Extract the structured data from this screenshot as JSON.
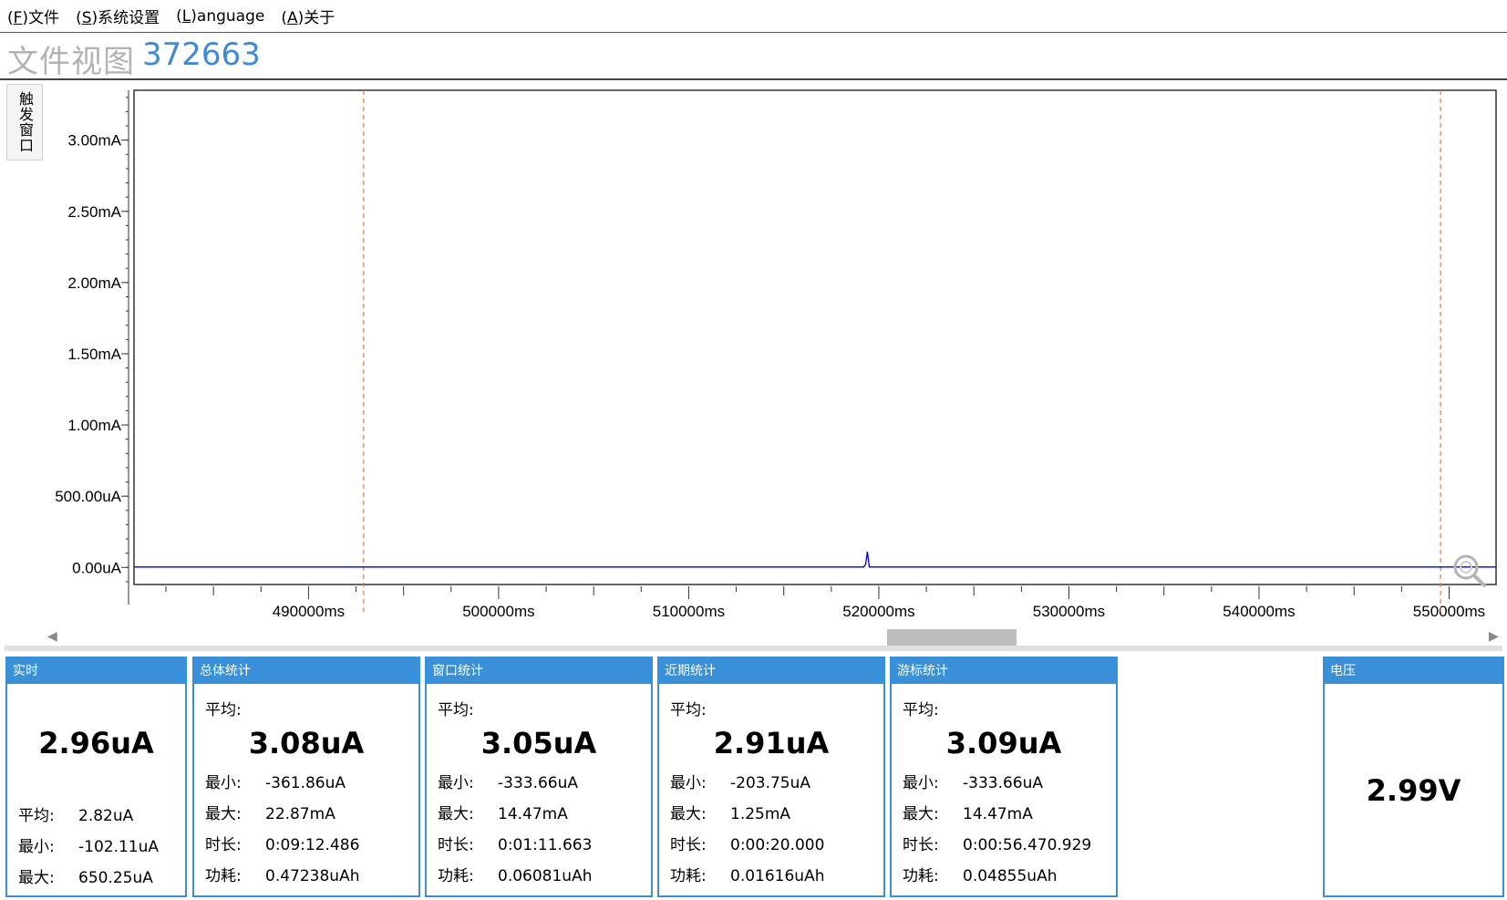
{
  "menu": [
    {
      "mnemonic": "F",
      "label": "文件"
    },
    {
      "mnemonic": "S",
      "label": "系统设置"
    },
    {
      "mnemonic": "L",
      "label": "anguage"
    },
    {
      "mnemonic": "A",
      "label": "关于"
    }
  ],
  "title": "文件视图",
  "title_id": "372663",
  "trigger_button": "触发窗口",
  "colors": {
    "accent": "#3a8fd9",
    "trace": "#0000cc",
    "cursor": "#d9834a"
  },
  "chart_data": {
    "type": "line",
    "y_ticks": [
      "3.00mA",
      "2.50mA",
      "2.00mA",
      "1.50mA",
      "1.00mA",
      "500.00uA",
      "0.00uA"
    ],
    "y_tick_values": [
      3.0,
      2.5,
      2.0,
      1.5,
      1.0,
      0.5,
      0.0
    ],
    "ylim": [
      -0.12,
      3.35
    ],
    "x_ticks": [
      "490000ms",
      "500000ms",
      "510000ms",
      "520000ms",
      "530000ms",
      "540000ms",
      "550000ms"
    ],
    "x_tick_values": [
      490000,
      500000,
      510000,
      520000,
      530000,
      540000,
      550000
    ],
    "xlim": [
      480820,
      552470
    ],
    "cursors_x": [
      492900,
      549550
    ],
    "series": [
      {
        "x": [
          480820,
          519200,
          519300,
          519400,
          519500,
          552470
        ],
        "y": [
          0.003,
          0.003,
          0.02,
          0.11,
          0.003,
          0.003
        ]
      }
    ]
  },
  "panels": [
    {
      "title": "实时",
      "big": "2.96uA",
      "rows": [
        {
          "label": "平均:",
          "value": "2.82uA"
        },
        {
          "label": "最小:",
          "value": "-102.11uA"
        },
        {
          "label": "最大:",
          "value": "650.25uA"
        }
      ]
    },
    {
      "title": "总体统计",
      "avg_label": "平均:",
      "big": "3.08uA",
      "rows": [
        {
          "label": "最小:",
          "value": "-361.86uA"
        },
        {
          "label": "最大:",
          "value": "22.87mA"
        },
        {
          "label": "时长:",
          "value": "0:09:12.486"
        },
        {
          "label": "功耗:",
          "value": "0.47238uAh"
        }
      ]
    },
    {
      "title": "窗口统计",
      "avg_label": "平均:",
      "big": "3.05uA",
      "rows": [
        {
          "label": "最小:",
          "value": "-333.66uA"
        },
        {
          "label": "最大:",
          "value": "14.47mA"
        },
        {
          "label": "时长:",
          "value": "0:01:11.663"
        },
        {
          "label": "功耗:",
          "value": "0.06081uAh"
        }
      ]
    },
    {
      "title": "近期统计",
      "avg_label": "平均:",
      "big": "2.91uA",
      "rows": [
        {
          "label": "最小:",
          "value": "-203.75uA"
        },
        {
          "label": "最大:",
          "value": "1.25mA"
        },
        {
          "label": "时长:",
          "value": "0:00:20.000"
        },
        {
          "label": "功耗:",
          "value": "0.01616uAh"
        }
      ]
    },
    {
      "title": "游标统计",
      "avg_label": "平均:",
      "big": "3.09uA",
      "rows": [
        {
          "label": "最小:",
          "value": "-333.66uA"
        },
        {
          "label": "最大:",
          "value": "14.47mA"
        },
        {
          "label": "时长:",
          "value": "0:00:56.470.929"
        },
        {
          "label": "功耗:",
          "value": "0.04855uAh"
        }
      ]
    },
    {
      "title": "电压",
      "big": "2.99V",
      "rows": []
    }
  ]
}
